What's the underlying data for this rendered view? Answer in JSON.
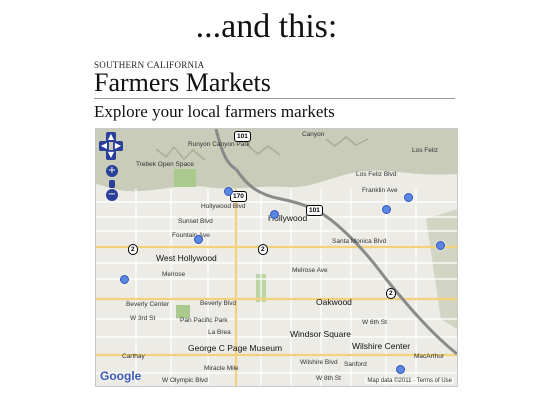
{
  "slide": {
    "title": "...and this:"
  },
  "header": {
    "region": "SOUTHERN CALIFORNIA",
    "title": "Farmers Markets",
    "subtitle": "Explore your local farmers markets"
  },
  "map": {
    "controls": {
      "pan_up": "▲",
      "pan_left": "◀",
      "pan_right": "▶",
      "pan_down": "▼",
      "zoom_in": "+",
      "zoom_out": "−"
    },
    "labels": {
      "west_hollywood": "West Hollywood",
      "hollywood": "Hollywood",
      "beverly_center": "Beverly Center",
      "pan_pacific_park": "Pan Pacific Park",
      "george_c_page": "George C Page Museum",
      "windsor_square": "Windsor Square",
      "wilshire_center": "Wilshire Center",
      "oakwood": "Oakwood",
      "los_feliz": "Los Feliz",
      "trebek_open_space": "Trebek Open Space",
      "runyon_canyon": "Runyon Canyon Park",
      "sunset_blvd": "Sunset Blvd",
      "hollywood_blvd": "Hollywood Blvd",
      "santa_monica_blvd": "Santa Monica Blvd",
      "fountain_ave": "Fountain Ave",
      "melrose_ave": "Melrose Ave",
      "melrose": "Melrose",
      "beverly_blvd": "Beverly Blvd",
      "w_3rd_st": "W 3rd St",
      "w_6th_st": "W 6th St",
      "w_8th_st": "W 8th St",
      "wilshire_blvd": "Wilshire Blvd",
      "la_brea": "La Brea",
      "franklin_ave": "Franklin Ave",
      "los_feliz_blvd": "Los Feliz Blvd",
      "w_olympic_blvd": "W Olympic Blvd",
      "carthay": "Carthay",
      "miracle_mile": "Miracle Mile",
      "sanford": "Sanford",
      "macarthur": "MacArthur",
      "canyon": "Canyon"
    },
    "shields": {
      "us101_top": "101",
      "us101_mid": "101",
      "ca170": "170",
      "ca2_west": "2",
      "ca2_mid": "2",
      "ca2_east": "2"
    },
    "google_logo": "Google",
    "attribution": "Map data ©2011 · Terms of Use",
    "colors": {
      "marker": "#5b86e5",
      "hills": "#c9ccb9",
      "park": "#a9c98d",
      "highway": "#8a8a8a"
    }
  }
}
